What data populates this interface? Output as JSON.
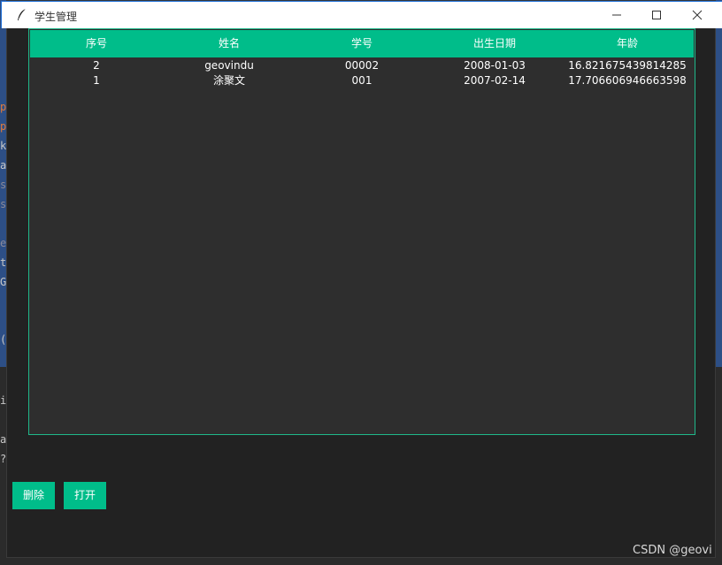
{
  "window": {
    "title": "学生管理"
  },
  "table": {
    "columns": [
      "序号",
      "姓名",
      "学号",
      "出生日期",
      "年龄"
    ],
    "rows": [
      {
        "seq": "2",
        "name": "geovindu",
        "student_no": "00002",
        "birth_date": "2008-01-03",
        "age": "16.821675439814285"
      },
      {
        "seq": "1",
        "name": "涂聚文",
        "student_no": "001",
        "birth_date": "2007-02-14",
        "age": "17.706606946663598"
      }
    ]
  },
  "buttons": {
    "delete_label": "删除",
    "open_label": "打开"
  },
  "watermark": "CSDN @geovi",
  "background_editor_glyphs": [
    "p",
    "p",
    "k",
    "a",
    "s",
    "s",
    "e",
    "t",
    "G",
    "(",
    "i",
    "a",
    "?"
  ],
  "colors": {
    "accent": "#00bd8a",
    "window_bg": "#222222",
    "table_bg": "#2e2e2e",
    "titlebar_bg": "#ffffff"
  }
}
